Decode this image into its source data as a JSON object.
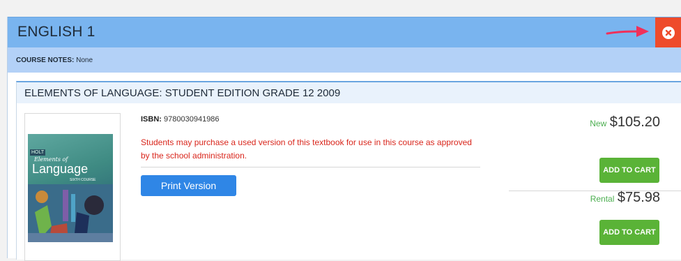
{
  "course": {
    "title": "ENGLISH 1",
    "notes_label": "COURSE NOTES:",
    "notes_value": "None",
    "close_icon": "close-circle-icon",
    "header_color": "#79b4ef",
    "close_color": "#ee4b2b"
  },
  "book": {
    "title": "ELEMENTS OF LANGUAGE: STUDENT EDITION GRADE 12 2009",
    "isbn_label": "ISBN:",
    "isbn_value": "9780030941986",
    "notice": "Students may purchase a used version of this textbook for use in this course as approved by the school administration.",
    "print_button": "Print Version",
    "cover": {
      "series": "HOLT",
      "line1": "Elements of",
      "line2": "Language",
      "line3": "SIXTH COURSE"
    }
  },
  "pricing": {
    "new_label": "New",
    "new_price": "$105.20",
    "rental_label": "Rental",
    "rental_price": "$75.98",
    "add_to_cart": "ADD TO CART",
    "add_to_cart_color": "#5ab337"
  },
  "annotation": {
    "arrow_color": "#f0305a"
  }
}
